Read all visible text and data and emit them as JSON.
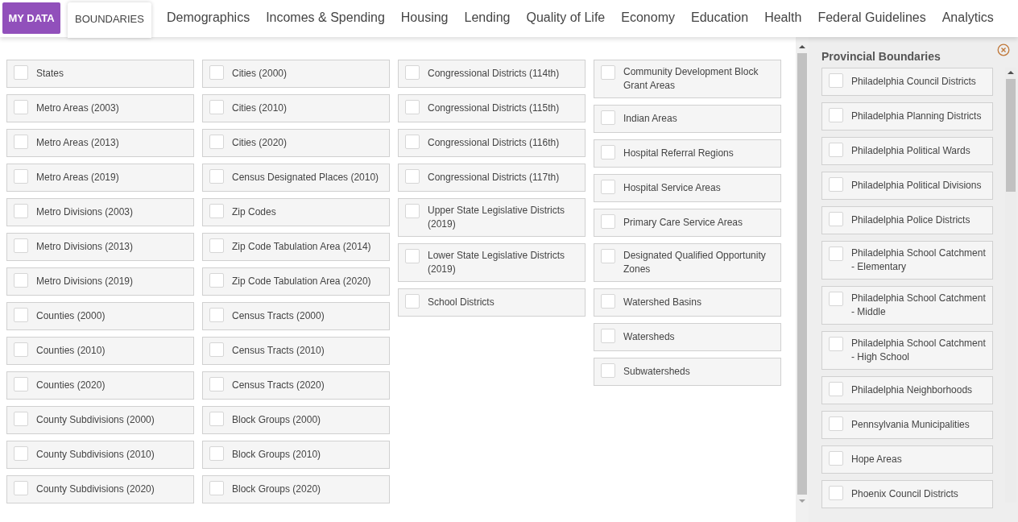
{
  "my_data_button": "MY DATA",
  "tabs": [
    {
      "label": "BOUNDARIES",
      "selected": true
    },
    {
      "label": "Demographics",
      "selected": false
    },
    {
      "label": "Incomes & Spending",
      "selected": false
    },
    {
      "label": "Housing",
      "selected": false
    },
    {
      "label": "Lending",
      "selected": false
    },
    {
      "label": "Quality of Life",
      "selected": false
    },
    {
      "label": "Economy",
      "selected": false
    },
    {
      "label": "Education",
      "selected": false
    },
    {
      "label": "Health",
      "selected": false
    },
    {
      "label": "Federal Guidelines",
      "selected": false
    },
    {
      "label": "Analytics",
      "selected": false
    }
  ],
  "columns": [
    [
      {
        "label": "States",
        "checked": false
      },
      {
        "label": "Metro Areas (2003)",
        "checked": false
      },
      {
        "label": "Metro Areas (2013)",
        "checked": false
      },
      {
        "label": "Metro Areas (2019)",
        "checked": false
      },
      {
        "label": "Metro Divisions (2003)",
        "checked": false
      },
      {
        "label": "Metro Divisions (2013)",
        "checked": false
      },
      {
        "label": "Metro Divisions (2019)",
        "checked": false
      },
      {
        "label": "Counties (2000)",
        "checked": false
      },
      {
        "label": "Counties (2010)",
        "checked": false
      },
      {
        "label": "Counties (2020)",
        "checked": false
      },
      {
        "label": "County Subdivisions (2000)",
        "checked": false
      },
      {
        "label": "County Subdivisions (2010)",
        "checked": false
      },
      {
        "label": "County Subdivisions (2020)",
        "checked": false
      }
    ],
    [
      {
        "label": "Cities (2000)",
        "checked": false
      },
      {
        "label": "Cities (2010)",
        "checked": false
      },
      {
        "label": "Cities (2020)",
        "checked": false
      },
      {
        "label": "Census Designated Places (2010)",
        "checked": false
      },
      {
        "label": "Zip Codes",
        "checked": false
      },
      {
        "label": "Zip Code Tabulation Area (2014)",
        "checked": false
      },
      {
        "label": "Zip Code Tabulation Area (2020)",
        "checked": false
      },
      {
        "label": "Census Tracts (2000)",
        "checked": false
      },
      {
        "label": "Census Tracts (2010)",
        "checked": false
      },
      {
        "label": "Census Tracts (2020)",
        "checked": false
      },
      {
        "label": "Block Groups (2000)",
        "checked": false
      },
      {
        "label": "Block Groups (2010)",
        "checked": false
      },
      {
        "label": "Block Groups (2020)",
        "checked": false
      }
    ],
    [
      {
        "label": "Congressional Districts (114th)",
        "checked": false
      },
      {
        "label": "Congressional Districts (115th)",
        "checked": false
      },
      {
        "label": "Congressional Districts (116th)",
        "checked": false
      },
      {
        "label": "Congressional Districts (117th)",
        "checked": false
      },
      {
        "label": "Upper State Legislative Districts (2019)",
        "checked": false
      },
      {
        "label": "Lower State Legislative Districts (2019)",
        "checked": false
      },
      {
        "label": "School Districts",
        "checked": false
      }
    ],
    [
      {
        "label": "Community Development Block Grant Areas",
        "checked": false
      },
      {
        "label": "Indian Areas",
        "checked": false
      },
      {
        "label": "Hospital Referral Regions",
        "checked": false
      },
      {
        "label": "Hospital Service Areas",
        "checked": false
      },
      {
        "label": "Primary Care Service Areas",
        "checked": false
      },
      {
        "label": "Designated Qualified Opportunity Zones",
        "checked": false
      },
      {
        "label": "Watershed Basins",
        "checked": false
      },
      {
        "label": "Watersheds",
        "checked": false
      },
      {
        "label": "Subwatersheds",
        "checked": false
      }
    ]
  ],
  "side_panel": {
    "title": "Provincial Boundaries",
    "items": [
      {
        "label": "Philadelphia Council Districts",
        "checked": false
      },
      {
        "label": "Philadelphia Planning Districts",
        "checked": false
      },
      {
        "label": "Philadelphia Political Wards",
        "checked": false
      },
      {
        "label": "Philadelphia Political Divisions",
        "checked": false
      },
      {
        "label": "Philadelphia Police Districts",
        "checked": false
      },
      {
        "label": "Philadelphia School Catchment - Elementary",
        "checked": false
      },
      {
        "label": "Philadelphia School Catchment - Middle",
        "checked": false
      },
      {
        "label": "Philadelphia School Catchment - High School",
        "checked": false
      },
      {
        "label": "Philadelphia Neighborhoods",
        "checked": false
      },
      {
        "label": "Pennsylvania Municipalities",
        "checked": false
      },
      {
        "label": "Hope Areas",
        "checked": false
      },
      {
        "label": "Phoenix Council Districts",
        "checked": false
      }
    ]
  }
}
